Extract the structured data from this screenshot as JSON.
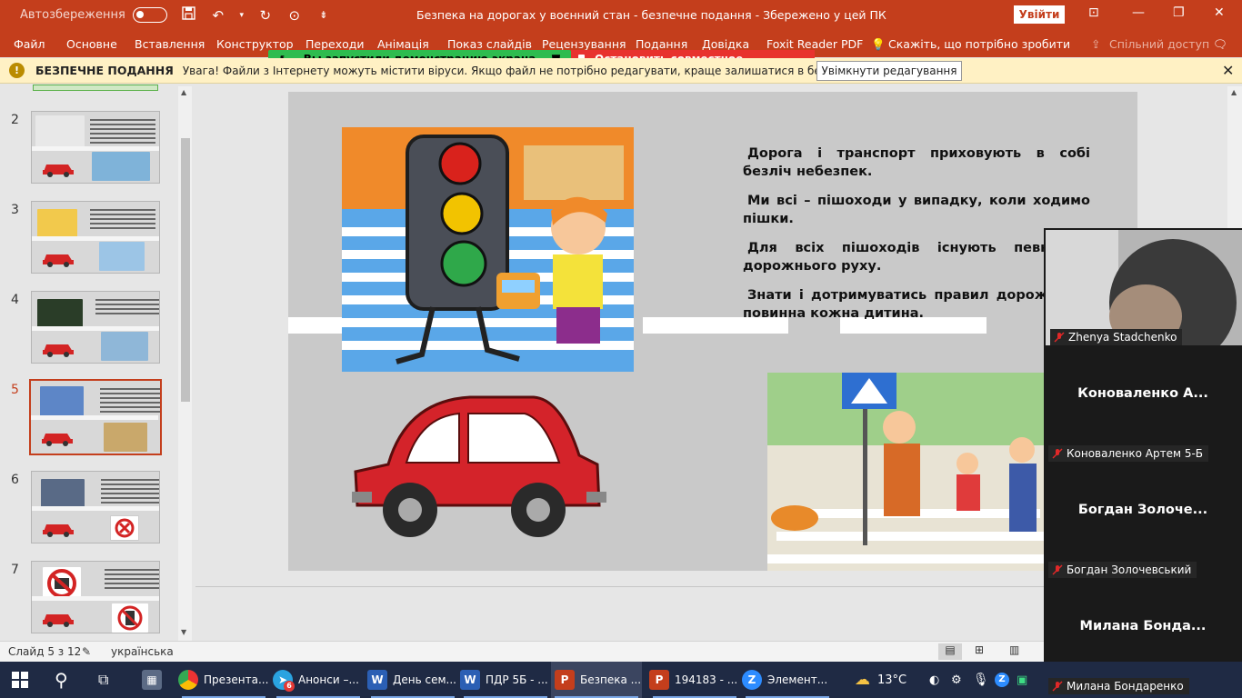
{
  "titlebar": {
    "autosave_label": "Автозбереження",
    "document_title": "Безпека на дорогах у воєнний стан  -  безпечне подання  -  Збережено у цей ПК",
    "signin_label": "Увійти",
    "icons": [
      "save-icon",
      "undo-icon",
      "redo-icon",
      "presenter-icon",
      "customize-icon"
    ]
  },
  "ribbon": {
    "tabs": [
      "Файл",
      "Основне",
      "Вставлення",
      "Конструктор",
      "Переходи",
      "Анімація",
      "Показ слайдів",
      "Рецензування",
      "Подання",
      "Довідка",
      "Foxit Reader PDF",
      "Скажіть, що потрібно зробити",
      "Спільний доступ"
    ]
  },
  "screenshare": {
    "status": "Вы запустили демонстрацию экрана",
    "stop": "Остановить совместное использование"
  },
  "protected_view": {
    "title": "БЕЗПЕЧНЕ ПОДАННЯ",
    "message": "Увага! Файли з Інтернету можуть містити віруси. Якщо файл не потрібно редагувати, краще залишатися в безпечному поданні.",
    "enable_button": "Увімкнути редагування"
  },
  "thumbnails": [
    {
      "num": "2"
    },
    {
      "num": "3"
    },
    {
      "num": "4"
    },
    {
      "num": "5"
    },
    {
      "num": "6"
    },
    {
      "num": "7"
    }
  ],
  "slide": {
    "paragraphs": [
      "Дорога і транспорт приховують в собі безліч небезпек.",
      "Ми всі – пішоходи у випадку, коли ходимо пішки.",
      "Для всіх пішоходів існують певні пр... дорожнього руху.",
      "Знати і дотримуватись правил дорож... руху повинна кожна дитина."
    ],
    "p1": "Дорога і транспорт приховують в собі безліч небезпек.",
    "p2": "Ми всі – пішоходи у випадку, коли ходимо пішки.",
    "p3": "Для всіх пішоходів існують певні пр дорожнього руху.",
    "p4": "Знати і дотримуватись правил дорож руху повинна кожна дитина."
  },
  "statusbar": {
    "slide_counter": "Слайд 5 з 12",
    "language": "українська"
  },
  "zoom": {
    "participants": [
      {
        "tile_name": "",
        "label": "Zhenya Stadchenko"
      },
      {
        "tile_name": "Коноваленко  А...",
        "label": "Коноваленко Артем 5-Б"
      },
      {
        "tile_name": "Богдан  Золоче...",
        "label": "Богдан Золочевський"
      },
      {
        "tile_name": "Милана  Бонда...",
        "label": "Милана Бондаренко"
      }
    ]
  },
  "taskbar": {
    "items": [
      {
        "label": "Презента...",
        "icon": "chrome-icon"
      },
      {
        "label": "Анонси –...",
        "icon": "telegram-icon",
        "badge": "6"
      },
      {
        "label": "День сем...",
        "icon": "word-icon"
      },
      {
        "label": "ПДР 5Б - ...",
        "icon": "word-icon"
      },
      {
        "label": "Безпека ...",
        "icon": "powerpoint-icon"
      },
      {
        "label": "194183  - ...",
        "icon": "powerpoint-icon"
      },
      {
        "label": "Элемент...",
        "icon": "zoom-icon"
      }
    ],
    "weather": "13°C"
  },
  "colors": {
    "accent": "#c43e1c",
    "share_green": "#2ebc4f",
    "share_red": "#e8322e",
    "protected_bar": "#fff1c4",
    "taskbar": "#1f2a44"
  }
}
